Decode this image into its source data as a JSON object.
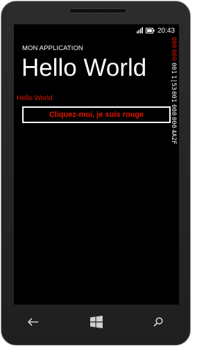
{
  "status_bar": {
    "icons": [
      "signal-icon",
      "battery-icon"
    ],
    "time": "20:43"
  },
  "app": {
    "application_title": "MON APPLICATION",
    "page_title": "Hello World"
  },
  "content": {
    "label_text": "Hello World",
    "button_label": "Cliquez-moi, je suis rouge"
  },
  "frame_rate_counter": [
    {
      "value": "000",
      "color": "#e51400"
    },
    {
      "value": "000",
      "color": "#e51400"
    },
    {
      "value": "001",
      "color": "#ffffff"
    },
    {
      "value": "1|53",
      "color": "#ffffff"
    },
    {
      "value": "001",
      "color": "#ffffff"
    },
    {
      "value": "000",
      "color": "#ffffff"
    },
    {
      "value": "000",
      "color": "#ffffff"
    },
    {
      "value": "4A2F",
      "color": "#ffffff"
    }
  ],
  "navigation": {
    "back": "back-icon",
    "start": "windows-start-icon",
    "search": "search-icon"
  },
  "colors": {
    "accent": "#e51400",
    "background": "#000000",
    "foreground": "#ffffff"
  }
}
